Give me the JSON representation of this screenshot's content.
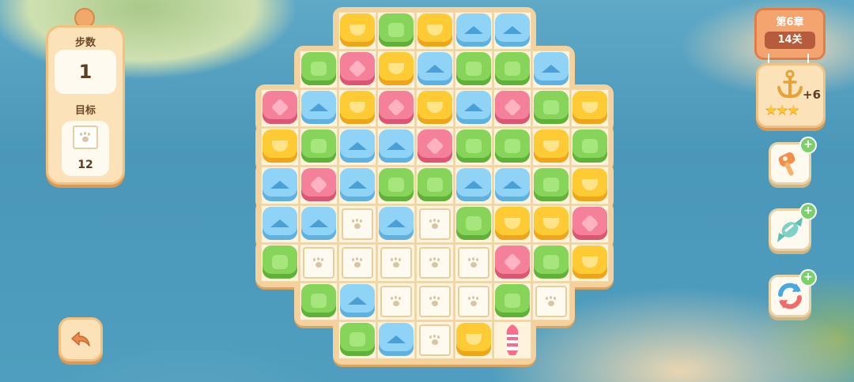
{
  "left_panel": {
    "moves_label": "步数",
    "moves_value": "1",
    "goal_label": "目标",
    "goal_count": "12",
    "goal_icon": "paw-box-icon"
  },
  "level": {
    "chapter": "第6章",
    "stage": "14关"
  },
  "reward": {
    "icon": "anchor-icon",
    "bonus": "+6",
    "stars": "★★★"
  },
  "boosters": [
    {
      "icon": "hammer-booster-icon",
      "badge": "+"
    },
    {
      "icon": "candy-booster-icon",
      "badge": "+"
    },
    {
      "icon": "shuffle-booster-icon",
      "badge": "+"
    }
  ],
  "controls": {
    "back_icon": "back-arrow-icon"
  },
  "board": {
    "rows": [
      "__YGYBB__",
      "_GPYBGGB_",
      "PBYPYBPGY",
      "YGBBPGGYG",
      "BPBGGBBGY",
      "BBXBXGYYP",
      "GXXXXXPGY",
      "_GBXXXGX_",
      "__GBXYR__"
    ],
    "legend": {
      "Y": "yellow",
      "G": "green",
      "B": "blue",
      "P": "pink",
      "X": "paw-box",
      "R": "striped-rocket",
      "_": "empty"
    }
  }
}
